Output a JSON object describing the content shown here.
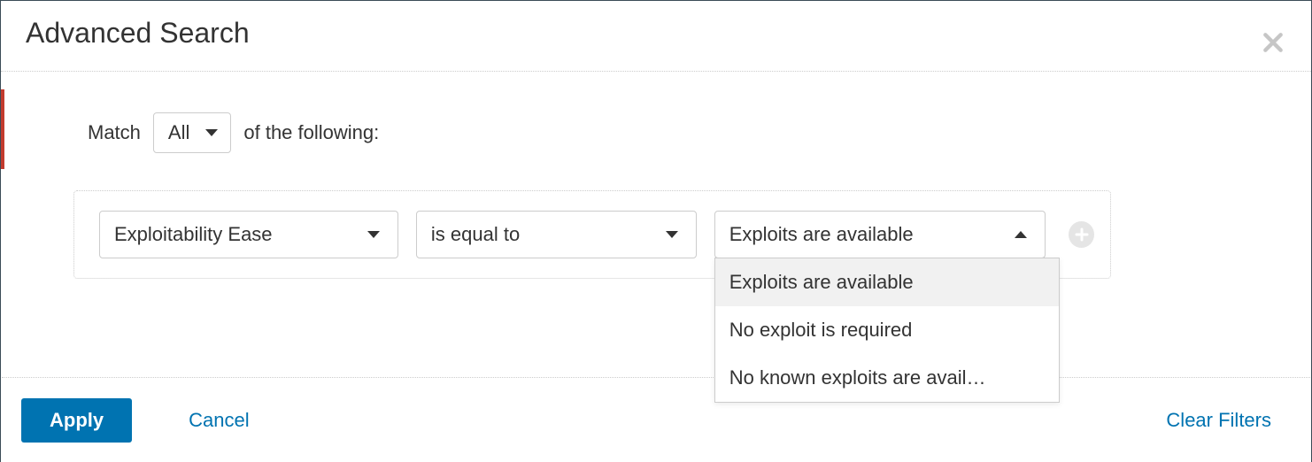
{
  "header": {
    "title": "Advanced Search"
  },
  "match": {
    "prefix": "Match",
    "selector_value": "All",
    "suffix": "of the following:"
  },
  "filter": {
    "field": "Exploitability Ease",
    "operator": "is equal to",
    "value": "Exploits are available",
    "options": [
      "Exploits are available",
      "No exploit is required",
      "No known exploits are avail…"
    ]
  },
  "footer": {
    "apply": "Apply",
    "cancel": "Cancel",
    "clear": "Clear Filters"
  }
}
